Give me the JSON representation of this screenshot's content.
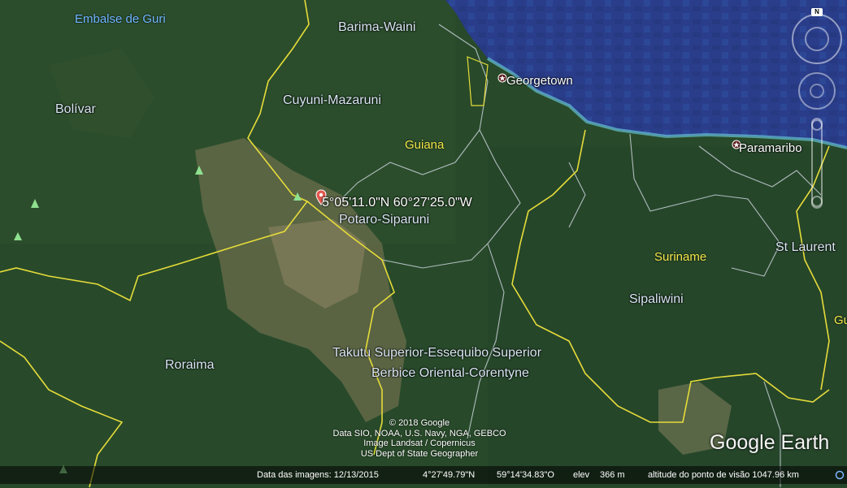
{
  "map": {
    "water_labels": {
      "guri": "Embalse de Guri"
    },
    "country_labels": {
      "guiana": "Guiana",
      "suriname": "Suriname"
    },
    "region_labels": {
      "barima": "Barima-Waini",
      "cuyuni": "Cuyuni-Mazaruni",
      "bolivar": "Bolívar",
      "potaro": "Potaro-Siparuni",
      "takutu": "Takutu Superior-Essequibo Superior",
      "berbice": "Berbice Oriental-Corentyne",
      "sipaliwini": "Sipaliwini",
      "roraima": "Roraima",
      "stlaurent": "St Laurent",
      "partial_g": "Gu"
    },
    "city_labels": {
      "georgetown": "Georgetown",
      "paramaribo": "Paramaribo"
    },
    "placemark": {
      "coordinates": "5°05'11.0\"N 60°27'25.0\"W",
      "icon": "red-pin-icon"
    },
    "colors": {
      "border": "#e6dc3a",
      "water": "#2c3f8c",
      "land": "#2a4a2c",
      "pin": "#e2564b"
    }
  },
  "attribution": {
    "lines": [
      "© 2018 Google",
      "Data SIO, NOAA, U.S. Navy, NGA, GEBCO",
      "Image Landsat / Copernicus",
      "US Dept of State Geographer"
    ],
    "logo": "Google Earth"
  },
  "navigation": {
    "north_label": "N",
    "icons": [
      "compass-ring-icon",
      "look-joystick-icon",
      "move-joystick-icon",
      "zoom-slider-icon"
    ]
  },
  "status_bar": {
    "imagery_date": "Data das imagens: 12/13/2015",
    "latitude": "4°27'49.79\"N",
    "longitude": "59°14'34.83\"O",
    "elev_label": "elev",
    "elev_value": "366 m",
    "eye_altitude": "altitude do ponto de visão 1047.96 km"
  }
}
